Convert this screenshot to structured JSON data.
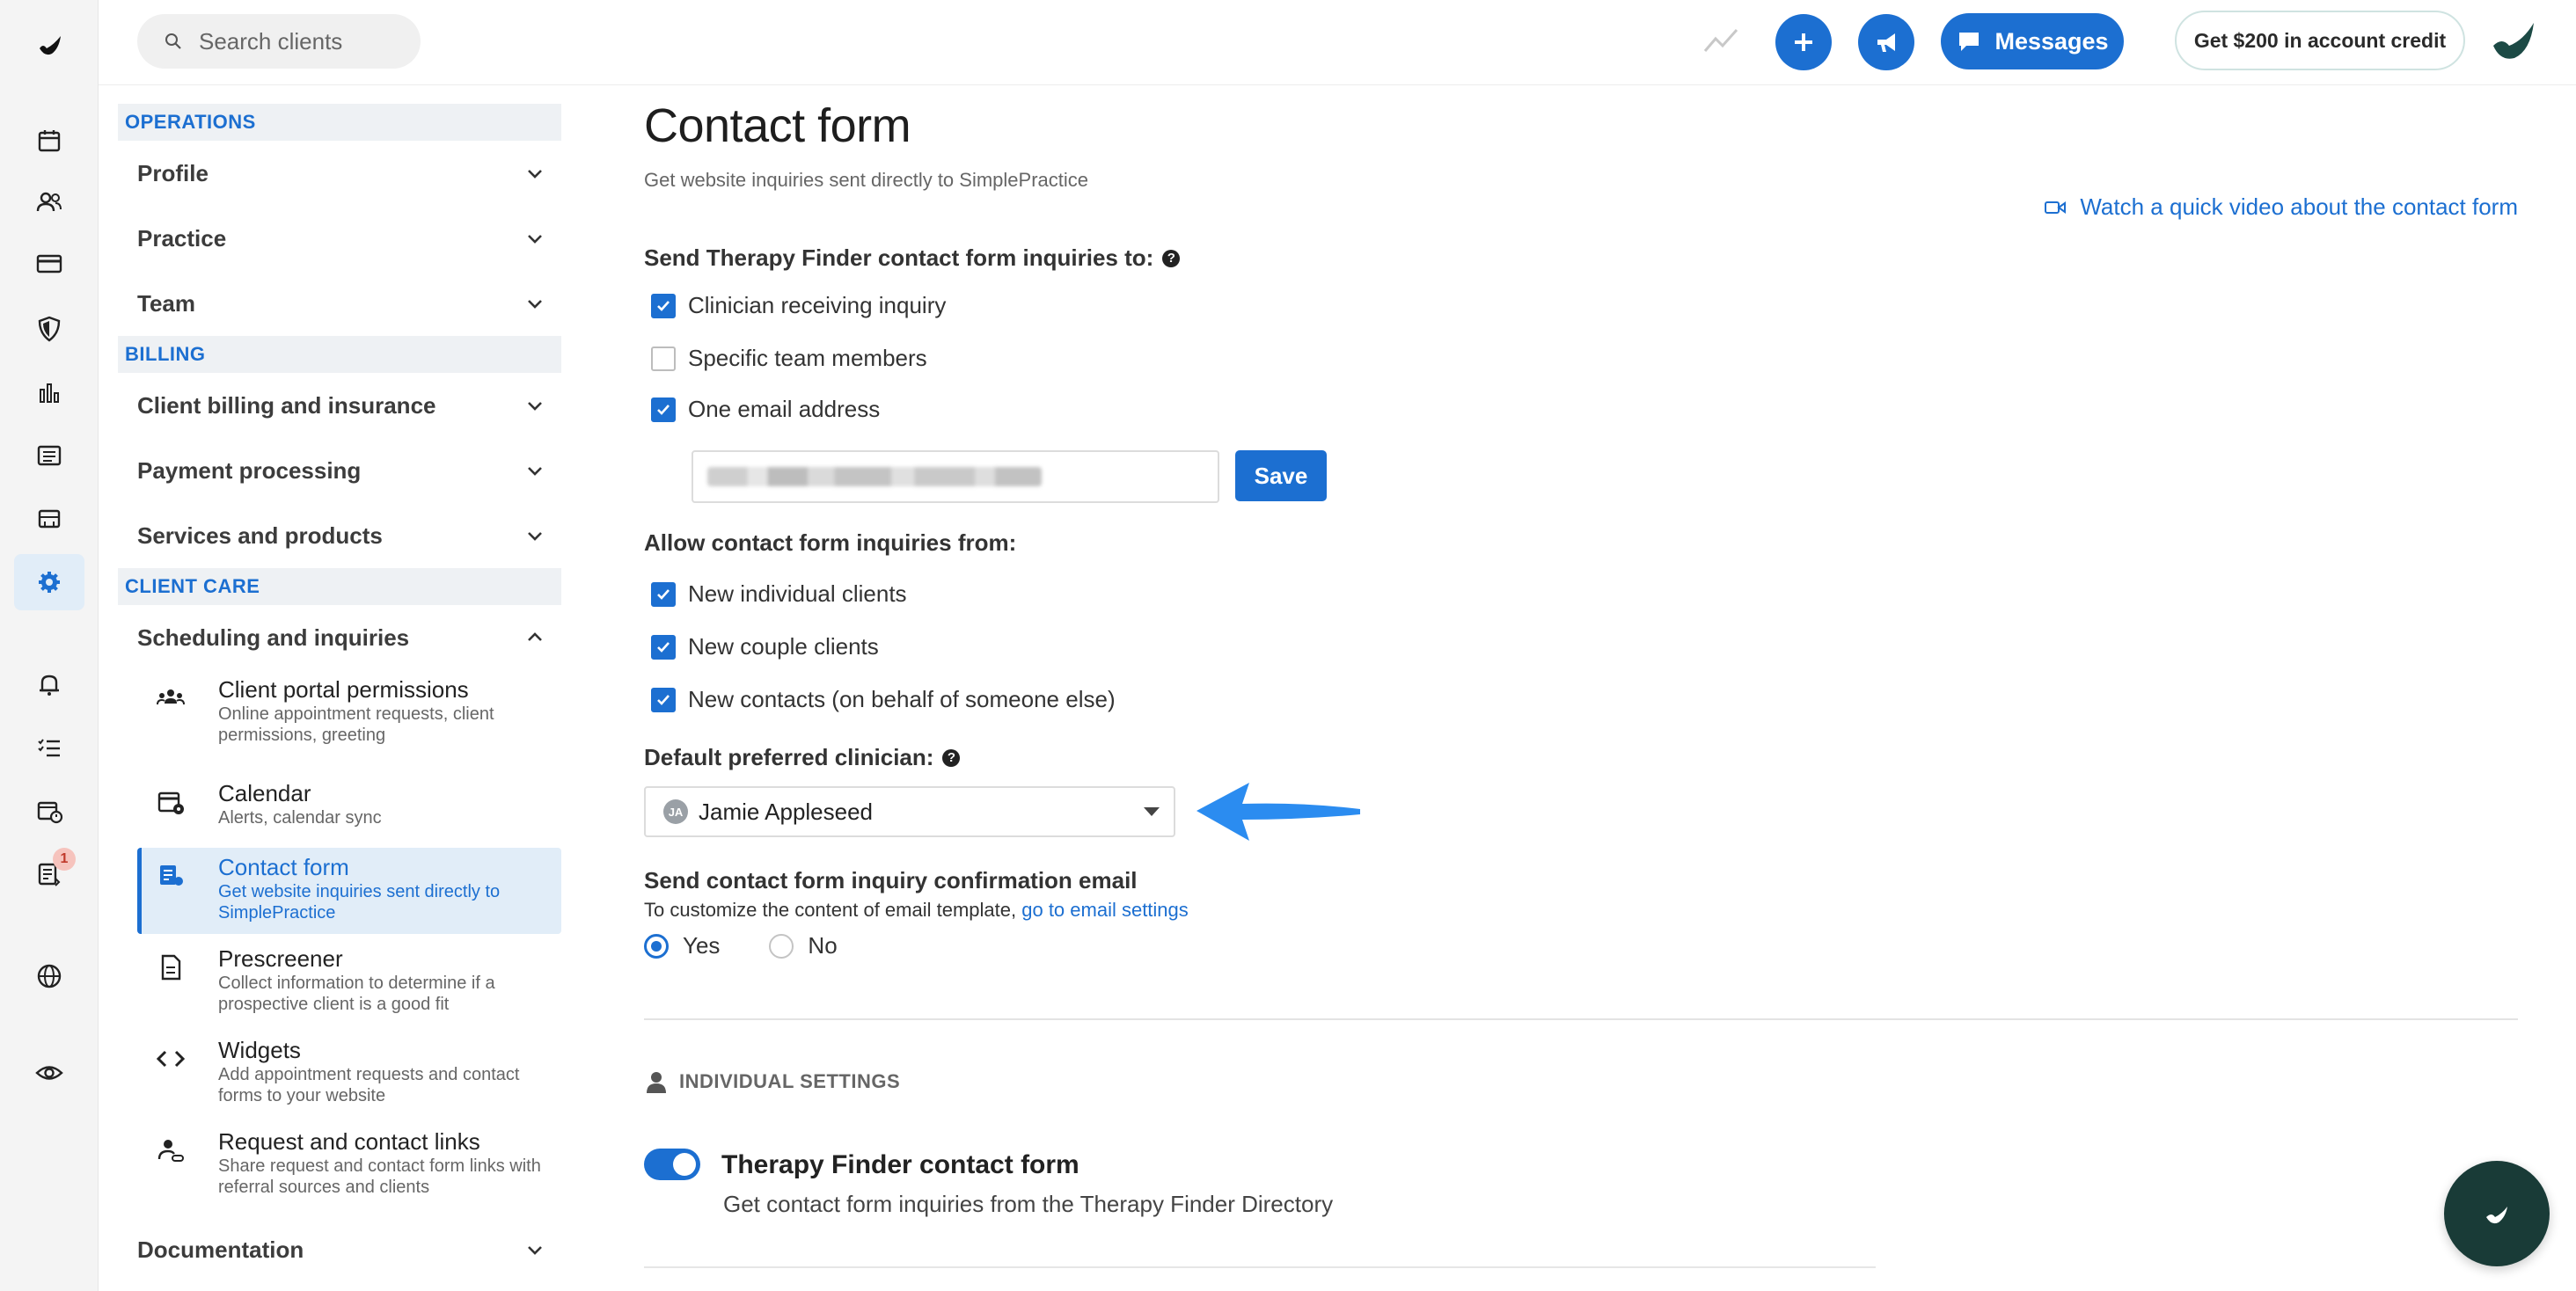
{
  "search": {
    "placeholder": "Search clients"
  },
  "topbar": {
    "messages_label": "Messages",
    "credit_label": "Get $200 in account credit"
  },
  "rail": {
    "icons": [
      "logo-icon",
      "calendar-icon",
      "clients-icon",
      "billing-card-icon",
      "insurance-shield-icon",
      "analytics-icon",
      "reports-icon",
      "marketplace-icon",
      "settings-gear-icon",
      "notifications-bell-icon",
      "tasks-list-icon",
      "appointments-icon",
      "requests-icon",
      "website-globe-icon",
      "eye-icon"
    ],
    "requests_badge": "1"
  },
  "nav": {
    "sections": {
      "operations": "OPERATIONS",
      "billing": "BILLING",
      "client_care": "CLIENT CARE"
    },
    "groups": {
      "profile": "Profile",
      "practice": "Practice",
      "team": "Team",
      "client_billing": "Client billing and insurance",
      "payment_processing": "Payment processing",
      "services_products": "Services and products",
      "scheduling": "Scheduling and inquiries",
      "documentation": "Documentation"
    },
    "sub_items": [
      {
        "title": "Client portal permissions",
        "desc": "Online appointment requests, client permissions, greeting"
      },
      {
        "title": "Calendar",
        "desc": "Alerts, calendar sync"
      },
      {
        "title": "Contact form",
        "desc": "Get website inquiries sent directly to SimplePractice"
      },
      {
        "title": "Prescreener",
        "desc": "Collect information to determine if a prospective client is a good fit"
      },
      {
        "title": "Widgets",
        "desc": "Add appointment requests and contact forms to your website"
      },
      {
        "title": "Request and contact links",
        "desc": "Share request and contact form links with referral sources and clients"
      }
    ]
  },
  "main": {
    "title": "Contact form",
    "subtitle": "Get website inquiries sent directly to SimplePractice",
    "video_link": "Watch a quick video about the contact form",
    "send_to_label": "Send Therapy Finder contact form inquiries to:",
    "send_to_options": [
      {
        "label": "Clinician receiving inquiry",
        "checked": true
      },
      {
        "label": "Specific team members",
        "checked": false
      },
      {
        "label": "One email address",
        "checked": true
      }
    ],
    "save_label": "Save",
    "allow_from_label": "Allow contact form inquiries from:",
    "allow_from_options": [
      {
        "label": "New individual clients",
        "checked": true
      },
      {
        "label": "New couple clients",
        "checked": true
      },
      {
        "label": "New contacts (on behalf of someone else)",
        "checked": true
      }
    ],
    "default_clinician_label": "Default preferred clinician:",
    "clinician_initials": "JA",
    "clinician_name": "Jamie Appleseed",
    "confirmation_label": "Send contact form inquiry confirmation email",
    "customize_text": "To customize the content of email template,",
    "customize_link": "go to email settings",
    "radio_yes": "Yes",
    "radio_no": "No",
    "individual_settings": "INDIVIDUAL SETTINGS",
    "toggle_title": "Therapy Finder contact form",
    "toggle_desc": "Get contact form inquiries from the Therapy Finder Directory"
  },
  "colors": {
    "accent": "#1c6fd1",
    "rail_bg": "#f4f4f4",
    "fab_bg": "#193b37"
  }
}
